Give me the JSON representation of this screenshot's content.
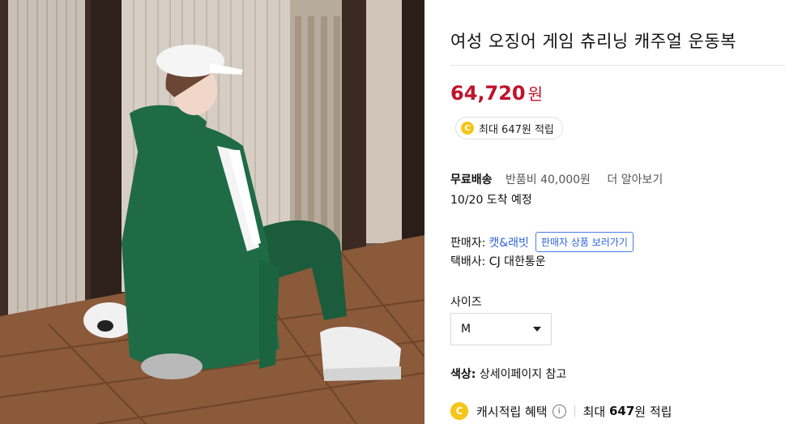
{
  "product": {
    "image_alt": "녹색 후드 트레이닝복을 입은 여성",
    "title": "여성 오징어 게임 츄리닝 캐주얼 운동복",
    "price": "64,720",
    "currency": "원",
    "reward_chip": "최대 647원 적립",
    "coin_glyph": "C"
  },
  "shipping": {
    "label": "무료배송",
    "return_fee": "반품비 40,000원",
    "more_link": "더 알아보기",
    "arrival": "10/20 도착 예정"
  },
  "seller": {
    "label": "판매자:",
    "name": "캣&래빗",
    "view_products": "판매자 상품 보러가기",
    "courier": "택배사: CJ 대한통운"
  },
  "options": {
    "size_label": "사이즈",
    "size_value": "M",
    "color_label": "색상:",
    "color_value": "상세이페이지 참고"
  },
  "cash": {
    "benefit_label": "캐시적립 혜택",
    "info_glyph": "i",
    "max_prefix": "최대",
    "max_amount": "647",
    "max_suffix": "원 적립"
  },
  "colors": {
    "price": "#c0132a",
    "link": "#2f64d6",
    "coin": "#f5c518",
    "jacket": "#1f6b45"
  }
}
